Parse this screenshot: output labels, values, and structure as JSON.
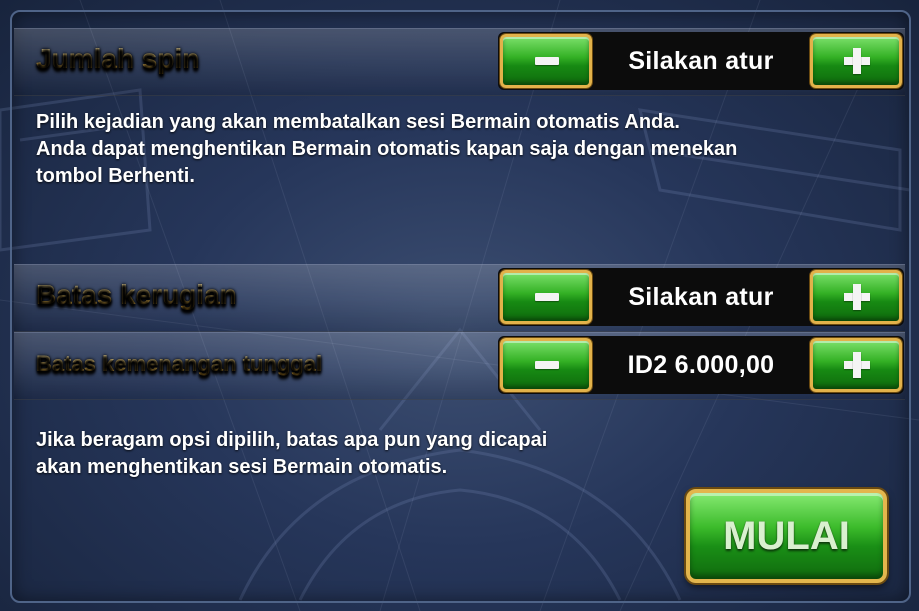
{
  "spin_count": {
    "label": "Jumlah spin",
    "value": "Silakan atur"
  },
  "spin_description": {
    "line1": "Pilih kejadian yang akan membatalkan sesi Bermain otomatis Anda.",
    "line2": "Anda dapat menghentikan Bermain otomatis kapan saja dengan menekan",
    "line3": "tombol Berhenti."
  },
  "loss_limit": {
    "label": "Batas kerugian",
    "value": "Silakan atur"
  },
  "single_win_limit": {
    "label": "Batas kemenangan tunggal",
    "value": "ID2 6.000,00"
  },
  "limits_description": {
    "line1": "Jika beragam opsi dipilih, batas apa pun yang dicapai",
    "line2": "akan menghentikan sesi Bermain otomatis."
  },
  "start_button": {
    "label": "MULAI"
  },
  "icons": {
    "minus": "minus-icon",
    "plus": "plus-icon"
  },
  "colors": {
    "label_gold": "#f4c65c",
    "button_green": "#34b125",
    "button_border": "#e2b24a",
    "panel_navy": "#26365a"
  }
}
